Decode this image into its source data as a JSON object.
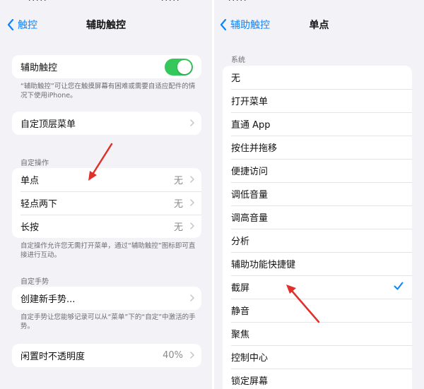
{
  "left": {
    "status_cut": "·····",
    "nav": {
      "back_label": "触控",
      "title": "辅助触控"
    },
    "toggle_row": {
      "label": "辅助触控",
      "state": "on"
    },
    "toggle_footer": "“辅助触控”可让您在触摸屏幕有困难或需要自适应配件的情况下使用iPhone。",
    "top_menu": {
      "label": "自定顶层菜单"
    },
    "custom_actions": {
      "header": "自定操作",
      "items": [
        {
          "label": "单点",
          "value": "无"
        },
        {
          "label": "轻点两下",
          "value": "无"
        },
        {
          "label": "长按",
          "value": "无"
        }
      ],
      "footer": "自定操作允许您无需打开菜单，通过“辅助触控”图标即可直接进行互动。"
    },
    "custom_gestures": {
      "header": "自定手势",
      "create_label": "创建新手势...",
      "footer": "自定手势让您能够记录可以从“菜单”下的“自定”中激活的手势。"
    },
    "idle_opacity": {
      "label": "闲置时不透明度",
      "value": "40%"
    }
  },
  "right": {
    "status_cut": "·····",
    "nav": {
      "back_label": "辅助触控",
      "title": "单点"
    },
    "section_header": "系统",
    "options": [
      {
        "label": "无",
        "checked": false
      },
      {
        "label": "打开菜单",
        "checked": false
      },
      {
        "label": "直通 App",
        "checked": false
      },
      {
        "label": "按住并拖移",
        "checked": false
      },
      {
        "label": "便捷访问",
        "checked": false
      },
      {
        "label": "调低音量",
        "checked": false
      },
      {
        "label": "调高音量",
        "checked": false
      },
      {
        "label": "分析",
        "checked": false
      },
      {
        "label": "辅助功能快捷键",
        "checked": false
      },
      {
        "label": "截屏",
        "checked": true
      },
      {
        "label": "静音",
        "checked": false
      },
      {
        "label": "聚焦",
        "checked": false
      },
      {
        "label": "控制中心",
        "checked": false
      },
      {
        "label": "锁定屏幕",
        "checked": false
      }
    ]
  },
  "colors": {
    "accent": "#0a84ff",
    "toggle_on": "#34c759",
    "annotation_arrow": "#e0302a"
  }
}
